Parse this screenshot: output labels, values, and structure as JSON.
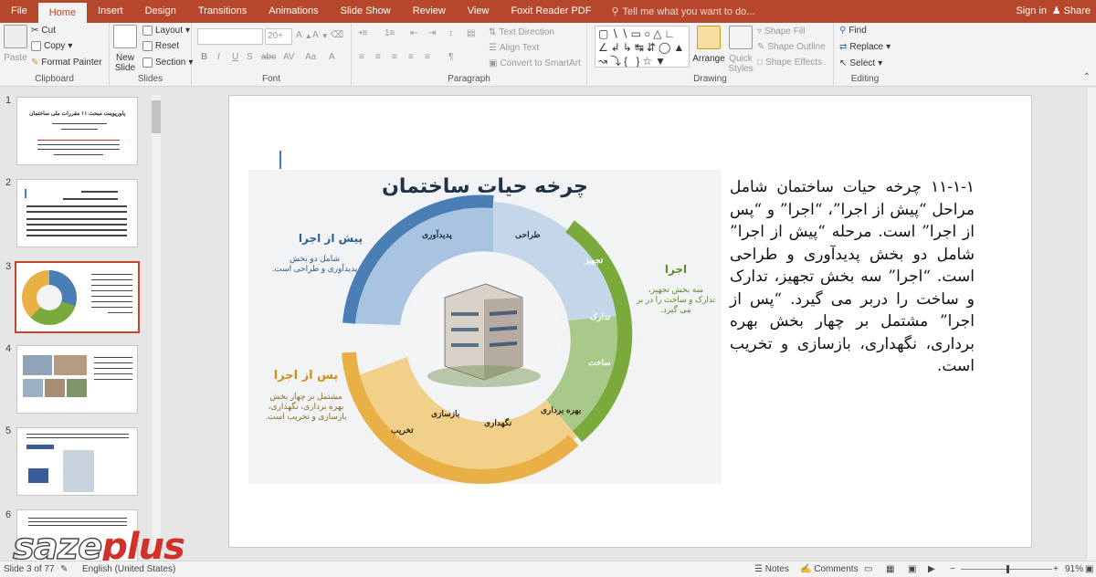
{
  "tabs": [
    "File",
    "Home",
    "Insert",
    "Design",
    "Transitions",
    "Animations",
    "Slide Show",
    "Review",
    "View",
    "Foxit Reader PDF"
  ],
  "tell_me": "Tell me what you want to do...",
  "account": {
    "signin": "Sign in",
    "share": "Share"
  },
  "ribbon": {
    "clipboard": {
      "label": "Clipboard",
      "paste": "Paste",
      "cut": "Cut",
      "copy": "Copy",
      "format_painter": "Format Painter"
    },
    "slides": {
      "label": "Slides",
      "new_slide": "New Slide",
      "layout": "Layout",
      "reset": "Reset",
      "section": "Section"
    },
    "font": {
      "label": "Font",
      "size_placeholder": "20+",
      "buttons": [
        "B",
        "I",
        "U",
        "S",
        "abc",
        "AV",
        "Aa",
        "A"
      ]
    },
    "paragraph": {
      "label": "Paragraph",
      "text_direction": "Text Direction",
      "align_text": "Align Text",
      "smartart": "Convert to SmartArt"
    },
    "drawing": {
      "label": "Drawing",
      "arrange": "Arrange",
      "quick_styles": "Quick Styles",
      "shape_fill": "Shape Fill",
      "shape_outline": "Shape Outline",
      "shape_effects": "Shape Effects"
    },
    "editing": {
      "label": "Editing",
      "find": "Find",
      "replace": "Replace",
      "select": "Select"
    }
  },
  "thumbnails": [
    {
      "num": "1",
      "title": "پاورپوینت مبحث ۱۱ مقررات ملی ساختمان"
    },
    {
      "num": "2",
      "title": ""
    },
    {
      "num": "3",
      "title": ""
    },
    {
      "num": "4",
      "title": ""
    },
    {
      "num": "5",
      "title": ""
    },
    {
      "num": "6",
      "title": ""
    }
  ],
  "diagram": {
    "title": "چرخه حیات ساختمان",
    "pre": {
      "heading": "پیش از اجرا",
      "desc1": "شامل دو بخش",
      "desc2": "پدیدآوری و طراحی است."
    },
    "exec": {
      "heading": "اجرا",
      "desc1": "سه بخش تجهیز،",
      "desc2": "تدارک و ساخت را در بر",
      "desc3": "می گیرد."
    },
    "post": {
      "heading": "پس از اجرا",
      "desc1": "مشتمل بر چهار بخش",
      "desc2": "بهره برداری، نگهداری،",
      "desc3": "بازسازی و تخریب است."
    },
    "segments": [
      "پدیدآوری",
      "طراحی",
      "تجهیز",
      "تدارک",
      "ساخت",
      "بهره برداری",
      "نگهداری",
      "بازسازی",
      "تخریب"
    ],
    "colors": {
      "blue": "#4a7fb5",
      "green": "#7aaa3c",
      "orange": "#e8b045",
      "title": "#1f3246"
    }
  },
  "slide_text": "۱۱-۱-۱ چرخه حیات ساختمان شامل مراحل “پیش از اجرا”، “اجرا” و “پس از اجرا” است. مرحله “پیش از اجرا” شامل دو بخش پدیدآوری و طراحی است. “اجرا” سه بخش تجهیز، تدارک و ساخت را دربر می گیرد. “پس از اجرا” مشتمل بر چهار بخش بهره برداری، نگهداری، بازسازی و تخریب است.",
  "status": {
    "slide": "Slide 3 of 77",
    "language": "English (United States)",
    "notes": "Notes",
    "comments": "Comments",
    "zoom": "91%"
  },
  "watermark": {
    "part1": "saze",
    "part2": "plus"
  }
}
